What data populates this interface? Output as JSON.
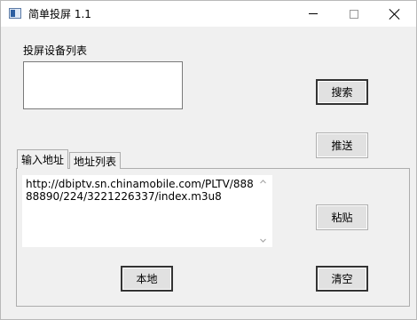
{
  "window": {
    "title": "简单投屏 1.1"
  },
  "devices": {
    "label": "投屏设备列表",
    "items": []
  },
  "buttons": {
    "search": "搜索",
    "push": "推送",
    "paste": "粘贴",
    "local": "本地",
    "clear": "清空"
  },
  "tabs": [
    {
      "label": "输入地址",
      "active": true
    },
    {
      "label": "地址列表",
      "active": false
    }
  ],
  "url_input": {
    "value": "http://dbiptv.sn.chinamobile.com/PLTV/88888890/224/3221226337/index.m3u8"
  }
}
